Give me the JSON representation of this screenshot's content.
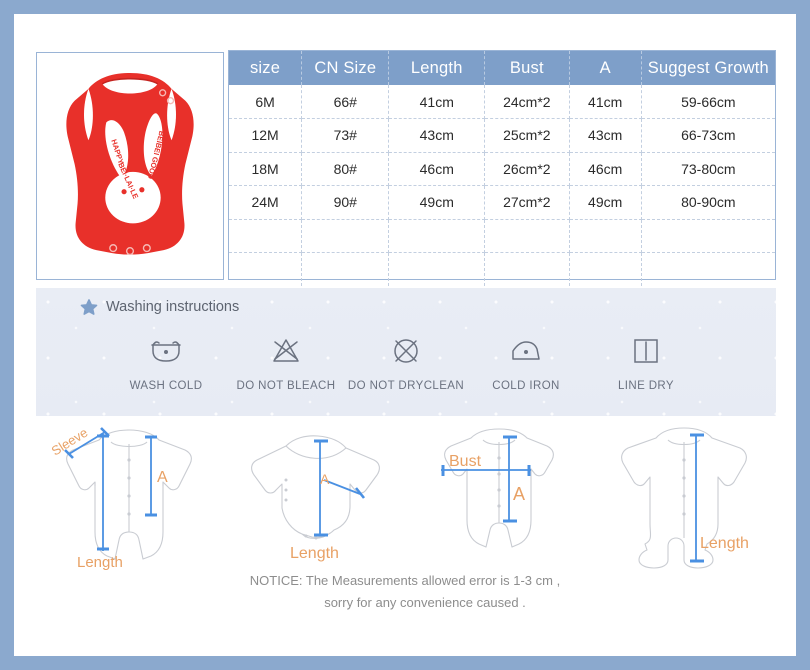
{
  "photo": {
    "alt_name": "red-sleeveless-baby-bodysuit",
    "garment_color": "#e8302a",
    "print_color": "#ffffff",
    "print_text_top": "HAPPY",
    "print_text_left": "BEI·LAI·LE",
    "print_text_right": "BEIBEI GOOD"
  },
  "table": {
    "headers": [
      "size",
      "CN Size",
      "Length",
      "Bust",
      "A",
      "Suggest Growth"
    ],
    "header_bg": "#7e9fc9",
    "rows": [
      [
        "6M",
        "66#",
        "41cm",
        "24cm*2",
        "41cm",
        "59-66cm"
      ],
      [
        "12M",
        "73#",
        "43cm",
        "25cm*2",
        "43cm",
        "66-73cm"
      ],
      [
        "18M",
        "80#",
        "46cm",
        "26cm*2",
        "46cm",
        "73-80cm"
      ],
      [
        "24M",
        "90#",
        "49cm",
        "27cm*2",
        "49cm",
        "80-90cm"
      ],
      [
        "",
        "",
        "",
        "",
        "",
        ""
      ],
      [
        "",
        "",
        "",
        "",
        "",
        ""
      ]
    ]
  },
  "washing": {
    "title": "Washing instructions",
    "star_icon": "star-icon",
    "items": [
      {
        "label": "WASH COLD",
        "icon": "wash-tub-icon"
      },
      {
        "label": "DO NOT BLEACH",
        "icon": "crossed-triangle-icon"
      },
      {
        "label": "DO NOT DRYCLEAN",
        "icon": "crossed-circle-icon"
      },
      {
        "label": "COLD IRON",
        "icon": "iron-icon"
      },
      {
        "label": "LINE DRY",
        "icon": "line-dry-icon"
      }
    ]
  },
  "diagrams": [
    {
      "name": "long-sleeve-romper",
      "labels": [
        "Sleeve",
        "A",
        "Length"
      ]
    },
    {
      "name": "long-sleeve-bodysuit",
      "labels": [
        "A",
        "Length"
      ]
    },
    {
      "name": "short-sleeve-romper",
      "labels": [
        "Bust",
        "A"
      ]
    },
    {
      "name": "footed-sleepsuit",
      "labels": [
        "Length"
      ]
    }
  ],
  "diagram_labels": {
    "sleeve": "Sleeve",
    "a": "A",
    "length": "Length",
    "bust": "Bust"
  },
  "notice": {
    "line1": "NOTICE:   The Measurements allowed error is 1-3 cm ,",
    "line2": "sorry for any convenience caused ."
  },
  "colors": {
    "frame": "#8ba9ce",
    "accent_blue": "#7e9fc9",
    "label_orange": "#e8a165",
    "arrow_blue": "#4a90e2",
    "outline_gray": "#c9ccd2"
  }
}
